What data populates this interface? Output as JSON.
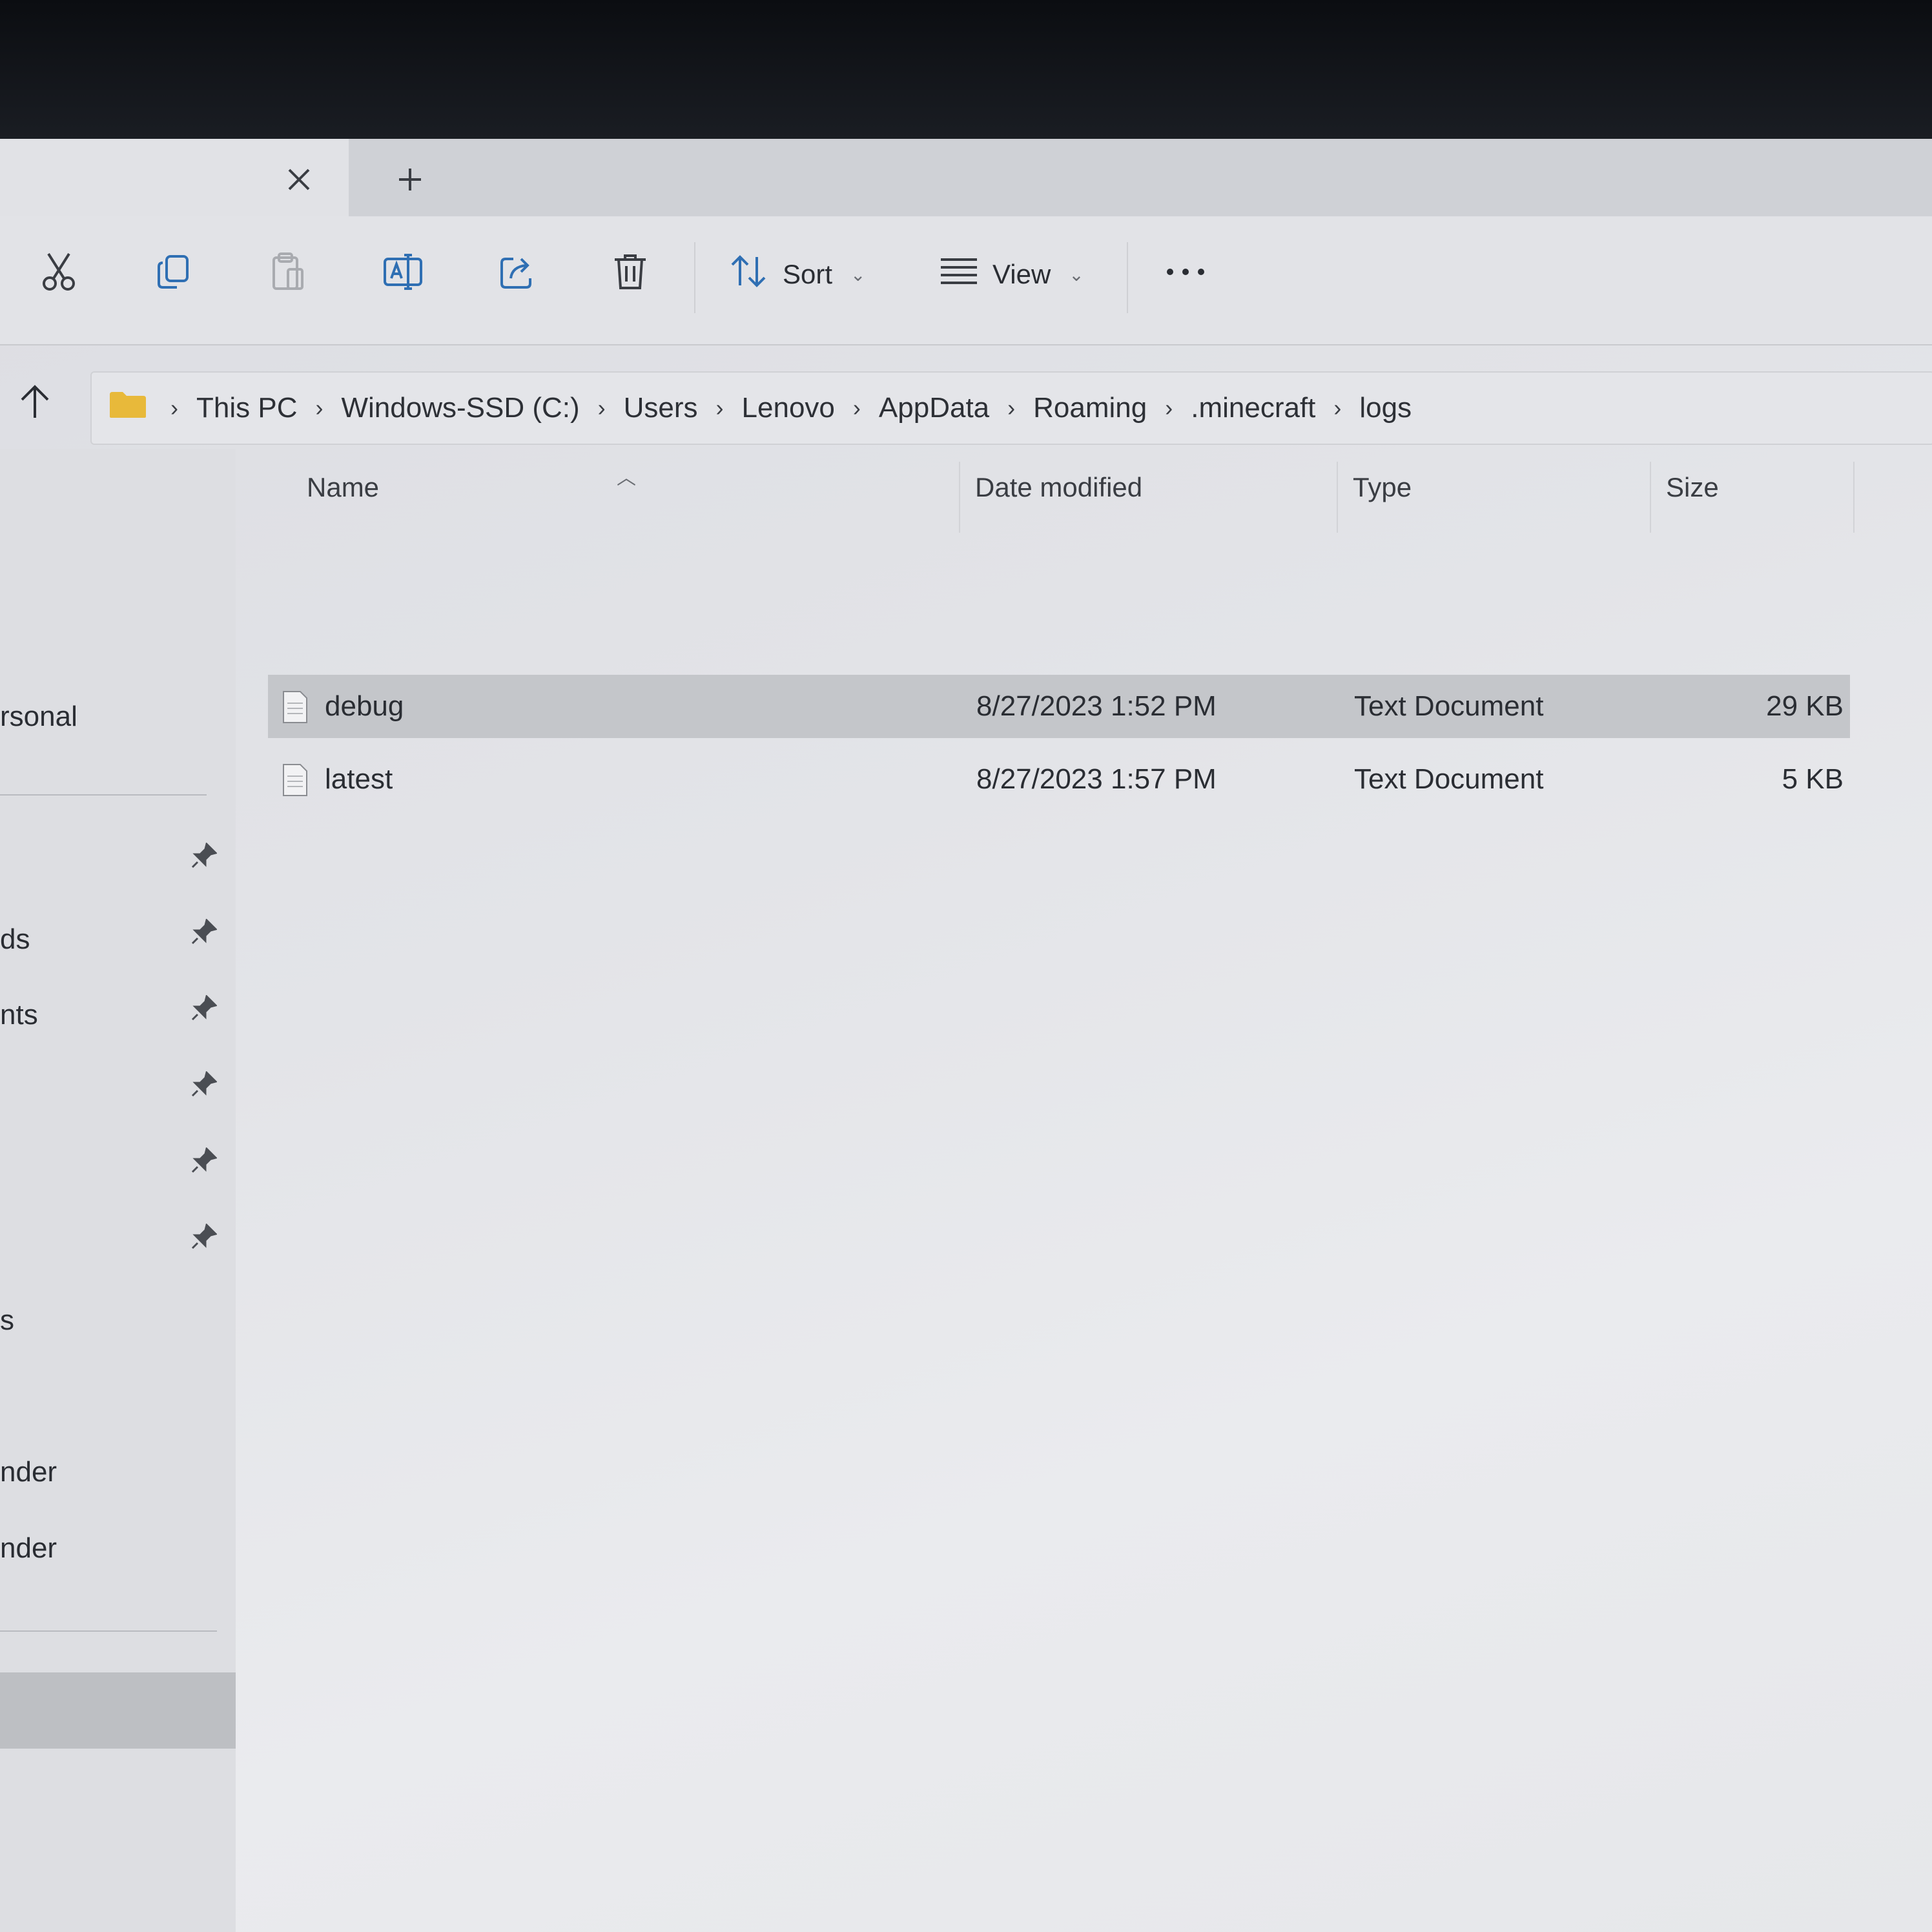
{
  "toolbar": {
    "sort_label": "Sort",
    "view_label": "View"
  },
  "address": {
    "breadcrumbs": [
      "This PC",
      "Windows-SSD (C:)",
      "Users",
      "Lenovo",
      "AppData",
      "Roaming",
      ".minecraft",
      "logs"
    ]
  },
  "sidebar": {
    "items": [
      "rsonal",
      "ds",
      "nts",
      "s",
      "nder",
      "nder"
    ]
  },
  "columns": {
    "name": "Name",
    "date": "Date modified",
    "type": "Type",
    "size": "Size"
  },
  "files": [
    {
      "name": "debug",
      "date": "8/27/2023 1:52 PM",
      "type": "Text Document",
      "size": "29 KB",
      "selected": true
    },
    {
      "name": "latest",
      "date": "8/27/2023 1:57 PM",
      "type": "Text Document",
      "size": "5 KB",
      "selected": false
    }
  ],
  "icons": [
    "close-icon",
    "plus-icon",
    "cut-icon",
    "copy-icon",
    "paste-icon",
    "rename-icon",
    "share-icon",
    "delete-icon",
    "sort-icon",
    "view-icon",
    "more-icon",
    "up-arrow-icon",
    "folder-icon",
    "pin-icon",
    "text-file-icon"
  ],
  "colors": {
    "selection": "#c4c6ca",
    "folder": "#e8b93a"
  }
}
